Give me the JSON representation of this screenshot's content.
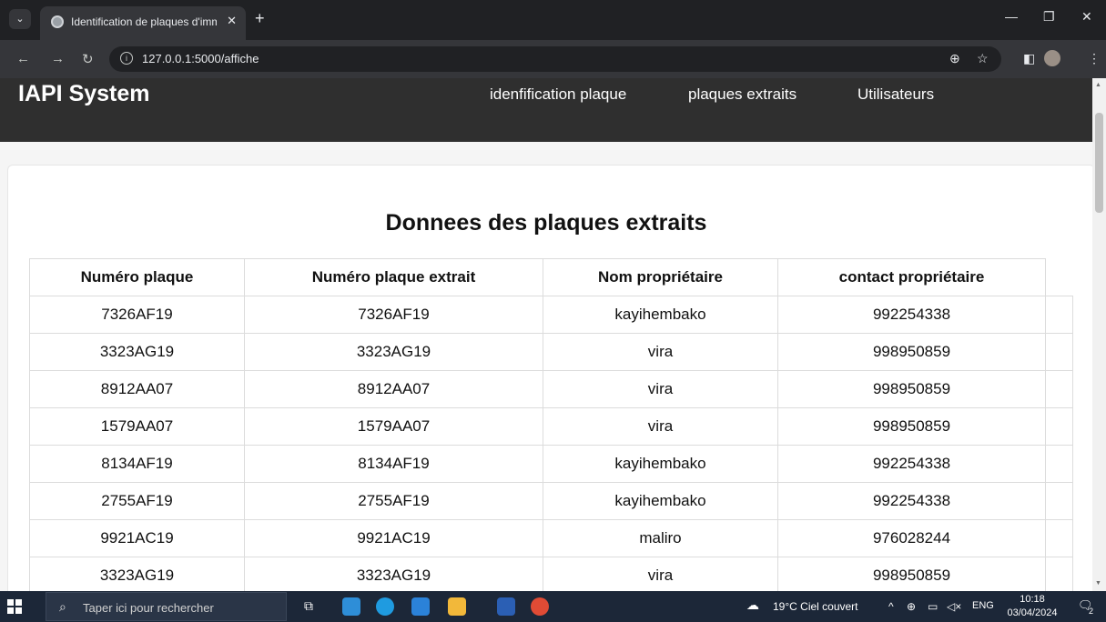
{
  "browser": {
    "tab_title": "Identification de plaques d'imm",
    "tab_close": "✕",
    "new_tab": "+",
    "url": "127.0.0.1:5000/affiche"
  },
  "app": {
    "brand": "IAPI System",
    "nav": [
      "idenfification plaque",
      "plaques extraits",
      "Utilisateurs"
    ]
  },
  "page": {
    "title": "Donnees des plaques extraits"
  },
  "table": {
    "headers": [
      "Numéro plaque",
      "Numéro plaque extrait",
      "Nom propriétaire",
      "contact propriétaire"
    ],
    "rows": [
      [
        "7326AF19",
        "7326AF19",
        "kayihembako",
        "992254338"
      ],
      [
        "3323AG19",
        "3323AG19",
        "vira",
        "998950859"
      ],
      [
        "8912AA07",
        "8912AA07",
        "vira",
        "998950859"
      ],
      [
        "1579AA07",
        "1579AA07",
        "vira",
        "998950859"
      ],
      [
        "8134AF19",
        "8134AF19",
        "kayihembako",
        "992254338"
      ],
      [
        "2755AF19",
        "2755AF19",
        "kayihembako",
        "992254338"
      ],
      [
        "9921AC19",
        "9921AC19",
        "maliro",
        "976028244"
      ],
      [
        "3323AG19",
        "3323AG19",
        "vira",
        "998950859"
      ]
    ]
  },
  "taskbar": {
    "search_placeholder": "Taper ici pour rechercher",
    "weather": "19°C  Ciel couvert",
    "language": "ENG",
    "time": "10:18",
    "date": "03/04/2024",
    "notification_count": "2"
  }
}
